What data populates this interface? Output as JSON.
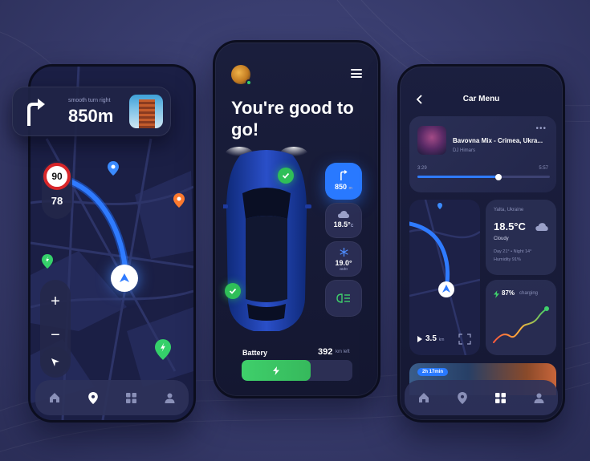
{
  "navigation_screen": {
    "turn_hint": "smooth turn right",
    "turn_distance": "850m",
    "speed_limit": "90",
    "current_speed": "78",
    "zoom_in_label": "+",
    "zoom_out_label": "−",
    "route_color": "#2979ff",
    "pin_colors": {
      "blue": "#3b8bff",
      "orange": "#ff7a2e",
      "green": "#35d06a"
    }
  },
  "home_screen": {
    "greeting": "You're good to go!",
    "turn_distance": "850",
    "turn_unit": "m",
    "temperature_outside": "18.5°",
    "temperature_outside_unit": "C",
    "temperature_climate": "19.0°",
    "climate_mode": "auto",
    "battery_label": "Battery",
    "range_value": "392",
    "range_unit": "km left",
    "battery_level": 0.62,
    "accent_blue": "#2979ff",
    "accent_green": "#3fcf6b"
  },
  "car_menu_screen": {
    "title": "Car Menu",
    "song_title": "Bavovna Mix - Crimea, Ukra...",
    "artist": "DJ Himars",
    "time_elapsed": "3:29",
    "time_total": "5:57",
    "progress": 0.61,
    "map_distance": "3.5",
    "map_distance_unit": "km",
    "weather": {
      "location": "Yalta, Ukraine",
      "temperature": "18.5°C",
      "condition": "Cloudy",
      "day_night": "Day 21° • Night 14°",
      "humidity": "Humidity 91%"
    },
    "charge_percent": "87%",
    "charge_label": "charging",
    "eta_badge": "2h 17min"
  }
}
